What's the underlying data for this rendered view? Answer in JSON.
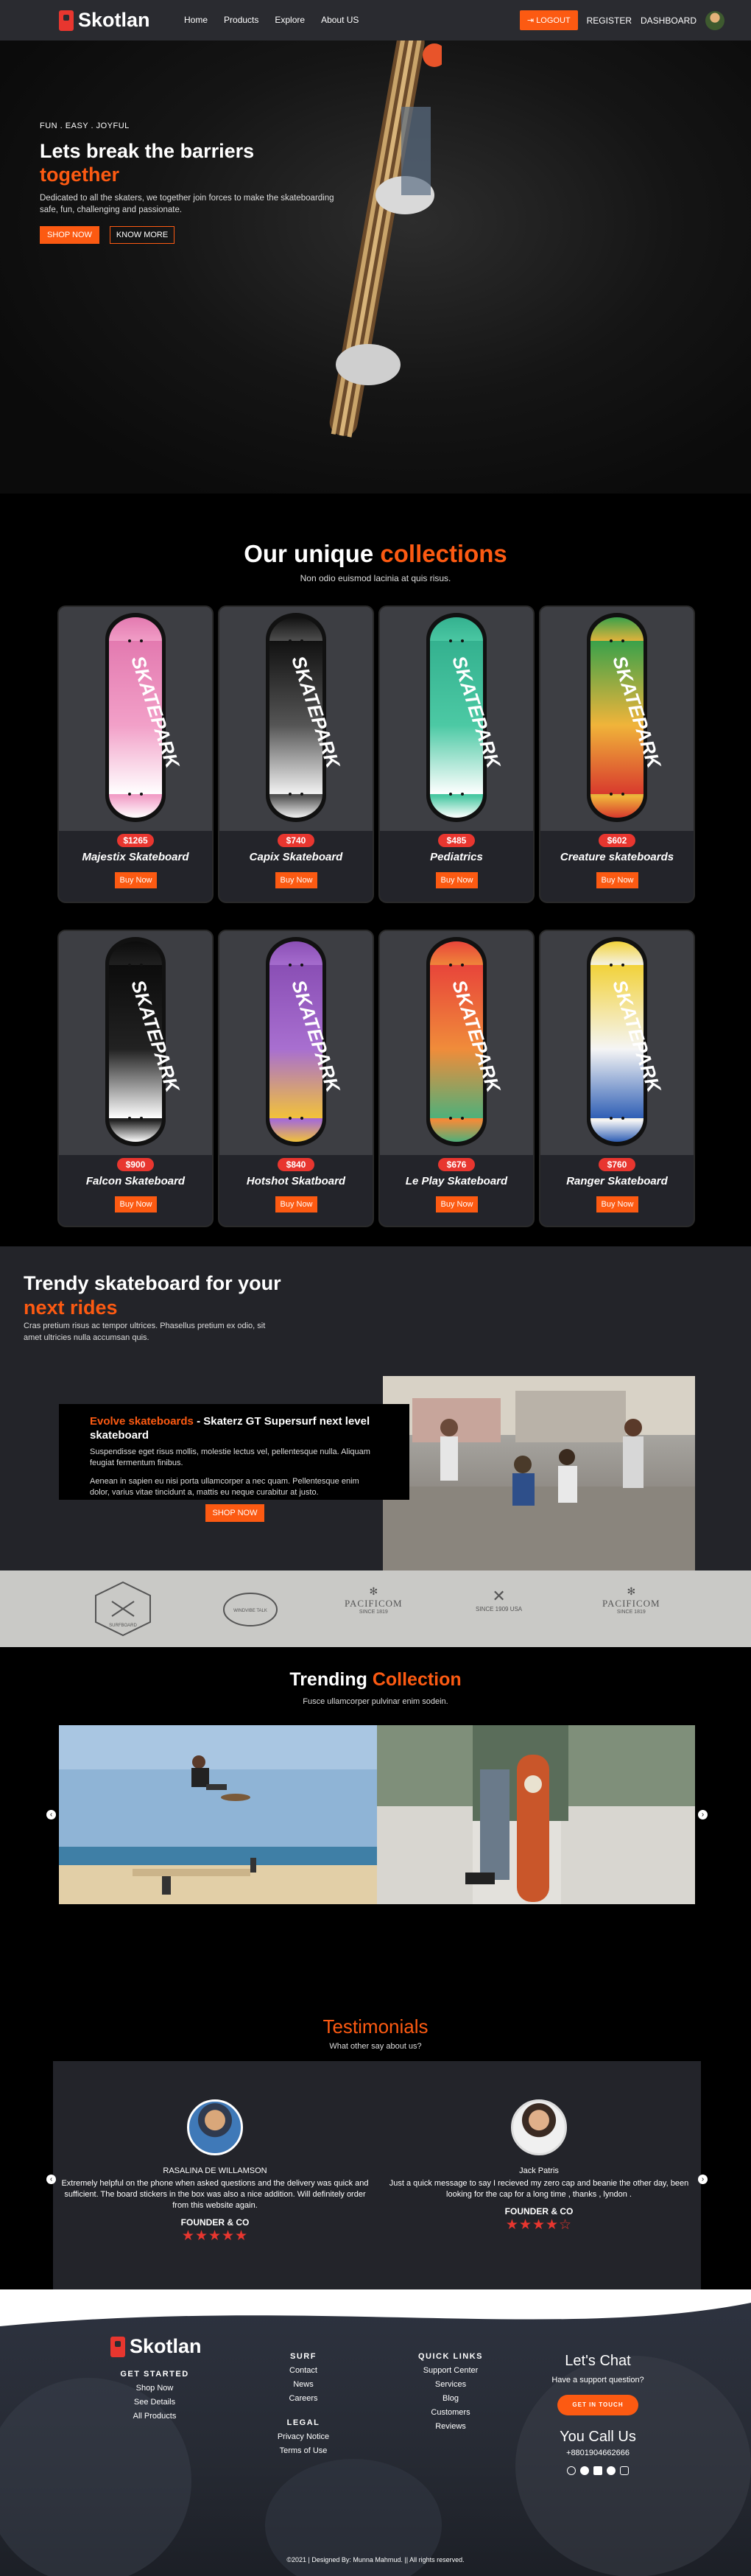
{
  "nav": {
    "brand": "Skotlan",
    "links": [
      "Home",
      "Products",
      "Explore",
      "About US"
    ],
    "logout": "LOGOUT",
    "register": "REGISTER",
    "dashboard": "DASHBOARD"
  },
  "hero": {
    "tagline": "FUN . EASY . JOYFUL",
    "title_line1": "Lets break the barriers",
    "title_line2": "together",
    "description": "Dedicated to all the skaters, we together join forces to make the skateboarding safe, fun, challenging and passionate.",
    "shop_now": "SHOP NOW",
    "know_more": "KNOW MORE"
  },
  "collections": {
    "title_white": "Our unique",
    "title_orange": "collections",
    "subtitle": "Non odio euismod lacinia at quis risus.",
    "buy_label": "Buy Now",
    "board_text": "SKATEPARK",
    "products": [
      {
        "name": "Majestix Skateboard",
        "price": "$1265",
        "colors": [
          "#e37ab0",
          "#f2a0c8",
          "#ffffff"
        ]
      },
      {
        "name": "Capix Skateboard",
        "price": "$740",
        "colors": [
          "#111111",
          "#555555",
          "#f2f2f2"
        ]
      },
      {
        "name": "Pediatrics",
        "price": "$485",
        "colors": [
          "#34b18f",
          "#4cc9a4",
          "#ffffff"
        ]
      },
      {
        "name": "Creature skateboards",
        "price": "$602",
        "colors": [
          "#3aa14a",
          "#f0b43a",
          "#d83a2d"
        ]
      },
      {
        "name": "Falcon Skateboard",
        "price": "$900",
        "colors": [
          "#0c0c0c",
          "#222222",
          "#ffffff"
        ]
      },
      {
        "name": "Hotshot Skatboard",
        "price": "$840",
        "colors": [
          "#8a4fb5",
          "#a86fd0",
          "#f2c23a"
        ]
      },
      {
        "name": "Le Play Skateboard",
        "price": "$676",
        "colors": [
          "#e8453a",
          "#f08c3a",
          "#4fb07a"
        ]
      },
      {
        "name": "Ranger Skateboard",
        "price": "$760",
        "colors": [
          "#f2d23a",
          "#f5f5f5",
          "#2f5fb5"
        ]
      }
    ]
  },
  "trendy": {
    "title_line1": "Trendy skateboard for your",
    "title_line2": "next rides",
    "description": "Cras pretium risus ac tempor ultrices. Phasellus pretium ex odio, sit amet ultricies nulla accumsan quis.",
    "feature_title_orange": "Evolve skateboards",
    "feature_title_white": "- Skaterz GT Supersurf next level skateboard",
    "feature_p1": "Suspendisse eget risus mollis, molestie lectus vel, pellentesque nulla. Aliquam feugiat fermentum finibus.",
    "feature_p2": "Aenean in sapien eu nisi porta ullamcorper a nec quam. Pellentesque enim dolor, varius vitae tincidunt a, mattis eu neque curabitur at justo.",
    "shop_now": "SHOP NOW"
  },
  "brands": [
    {
      "name": "SURFBOARD",
      "sub": "EST"
    },
    {
      "name": "WINDVIBE TALK",
      "sub": ""
    },
    {
      "name": "PACIFICOM",
      "sub": "SINCE 1819"
    },
    {
      "name": "SINCE 1909 USA",
      "sub": ""
    },
    {
      "name": "PACIFICOM",
      "sub": "SINCE 1819"
    }
  ],
  "trending": {
    "title_white": "Trending",
    "title_orange": "Collection",
    "subtitle": "Fusce ullamcorper pulvinar enim sodein."
  },
  "testimonials": {
    "title": "Testimonials",
    "subtitle": "What other say about us?",
    "items": [
      {
        "name": "RASALINA DE WILLAMSON",
        "text": "Extremely helpful on the phone when asked questions and the delivery was quick and sufficient. The board stickers in the box was also a nice addition. Will definitely order from this website again.",
        "role": "FOUNDER & CO",
        "stars": "★★★★★"
      },
      {
        "name": "Jack Patris",
        "text": "Just a quick message to say I recieved my zero cap and beanie the other day, been looking for the cap for a long time , thanks , lyndon .",
        "role": "FOUNDER & CO",
        "stars": "★★★★☆"
      }
    ]
  },
  "footer": {
    "brand": "Skotlan",
    "get_started": {
      "head": "GET STARTED",
      "items": [
        "Shop Now",
        "See Details",
        "All Products"
      ]
    },
    "surf": {
      "head": "SURF",
      "items": [
        "Contact",
        "News",
        "Careers"
      ]
    },
    "legal": {
      "head": "LEGAL",
      "items": [
        "Privacy Notice",
        "Terms of Use"
      ]
    },
    "quick_links": {
      "head": "QUICK LINKS",
      "items": [
        "Support Center",
        "Services",
        "Blog",
        "Customers",
        "Reviews"
      ]
    },
    "chat_title": "Let's Chat",
    "chat_sub": "Have a support question?",
    "get_in_touch": "GET IN TOUCH",
    "call_title": "You Call Us",
    "phone": "+8801904662666",
    "copyright": "©2021 | Designed By: Munna Mahmud. || All rights reserved."
  }
}
